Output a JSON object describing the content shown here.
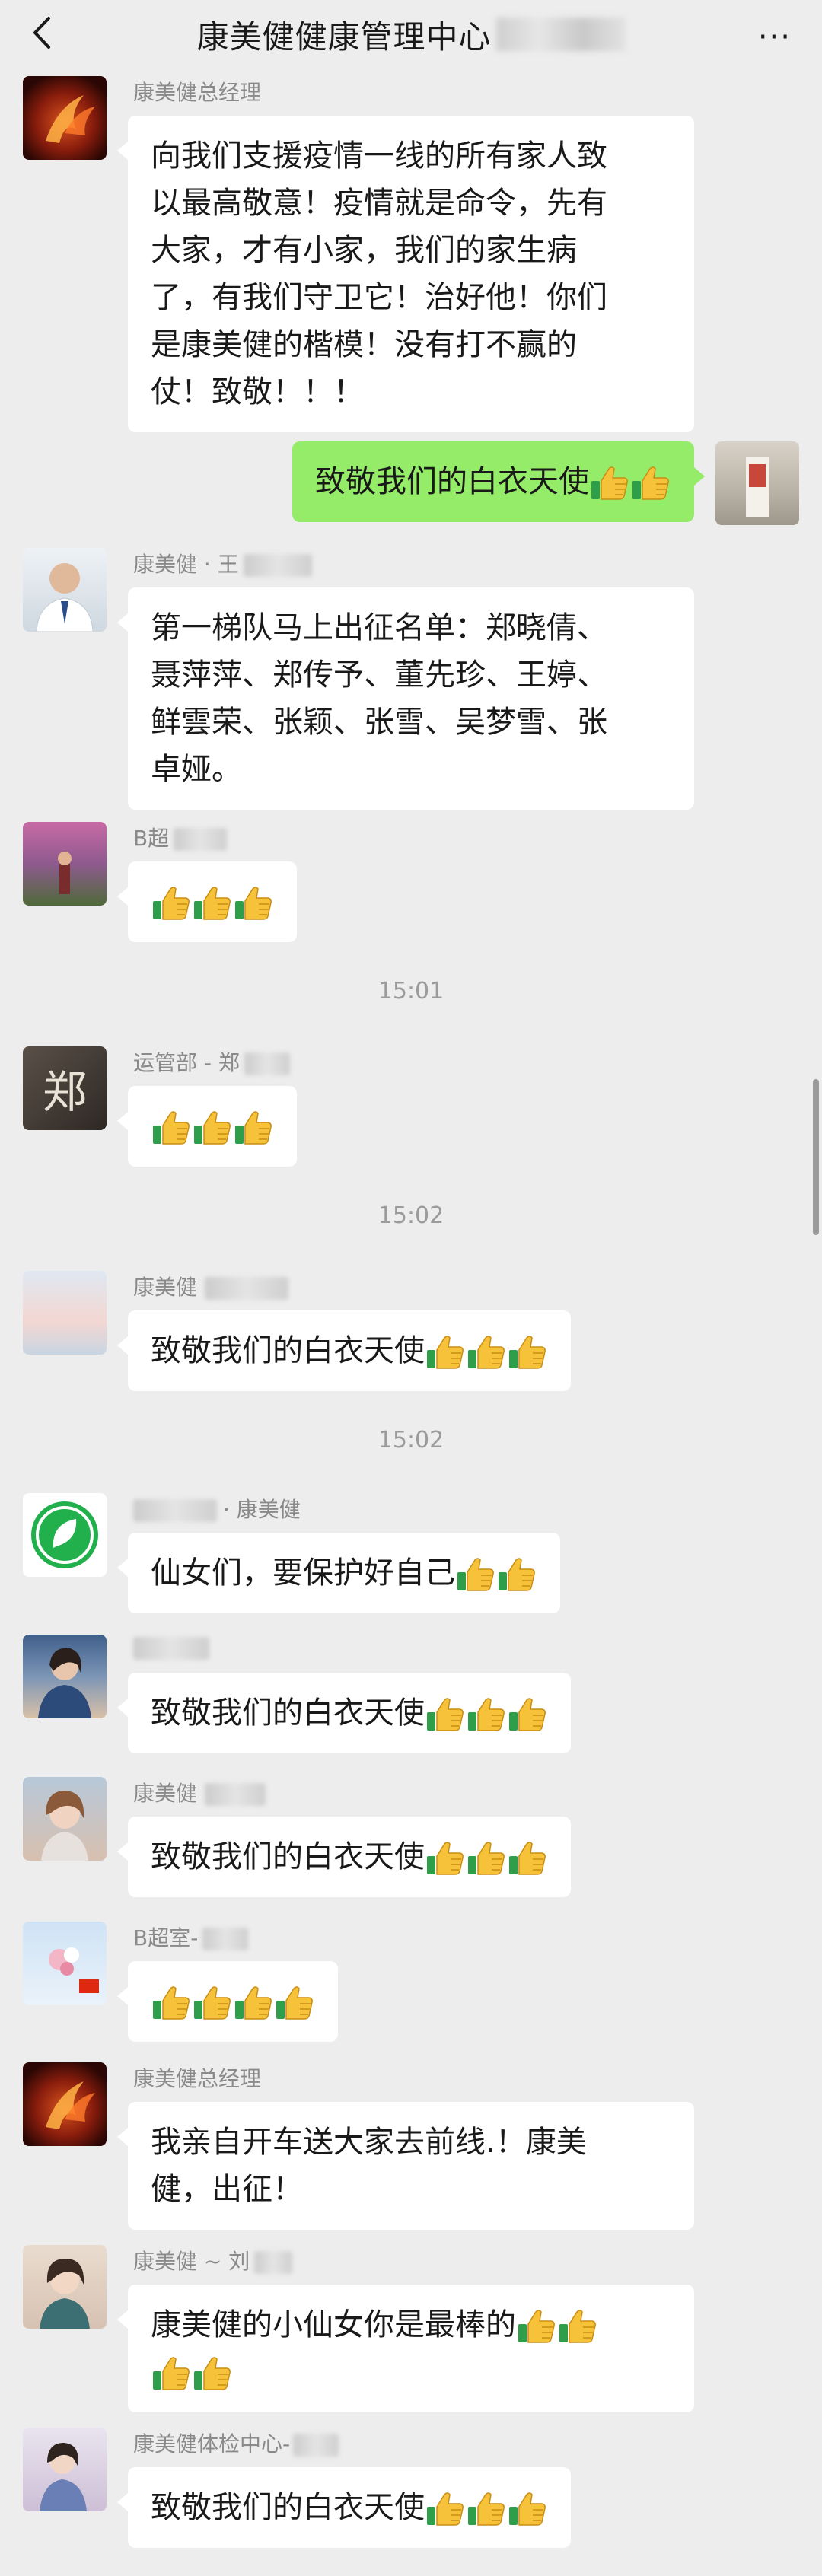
{
  "header": {
    "title": "康美健健康管理中心",
    "more": "···"
  },
  "messages": {
    "m1": {
      "sender": "康美健总经理",
      "lines": [
        "向我们支援疫情一线的所有家人致",
        "以最高敬意！疫情就是命令，先有",
        "大家，才有小家，我们的家生病",
        "了，有我们守卫它！治好他！你们",
        "是康美健的楷模！没有打不赢的",
        "仗！致敬！！！"
      ]
    },
    "m2": {
      "text": "致敬我们的白衣天使"
    },
    "m3": {
      "sender": "康美健 · 王",
      "lines": [
        "第一梯队马上出征名单：郑晓倩、",
        "聂萍萍、郑传予、董先珍、王婷、",
        "鲜雲荣、张颖、张雪、吴梦雪、张",
        "卓娅。"
      ]
    },
    "m4": {
      "sender": "B超"
    },
    "t1": "15:01",
    "m5": {
      "sender": "运管部 - 郑",
      "avatar_char": "郑"
    },
    "t2": "15:02",
    "m6": {
      "sender": "康美健",
      "text": "致敬我们的白衣天使"
    },
    "t3": "15:02",
    "m7": {
      "sender": "· 康美健",
      "text": "仙女们，要保护好自己"
    },
    "m8": {
      "text": "致敬我们的白衣天使"
    },
    "m9": {
      "sender": "康美健",
      "text": "致敬我们的白衣天使"
    },
    "m10": {
      "sender": "B超室-"
    },
    "m11": {
      "sender": "康美健总经理",
      "lines": [
        "我亲自开车送大家去前线.！康美",
        "健，出征！"
      ]
    },
    "m12": {
      "sender": "康美健 ~ 刘",
      "lines": [
        "康美健的小仙女你是最棒的"
      ]
    },
    "m13": {
      "sender": "康美健体检中心-",
      "text": "致敬我们的白衣天使"
    }
  },
  "icons": {
    "thumb": "thumbs-up-emoji",
    "back": "chevron-left-icon",
    "more": "more-dots-icon"
  },
  "colors": {
    "background": "#ededed",
    "bubble_self": "#95ec69",
    "bubble_other": "#ffffff",
    "meta_text": "#8a8a8a"
  }
}
